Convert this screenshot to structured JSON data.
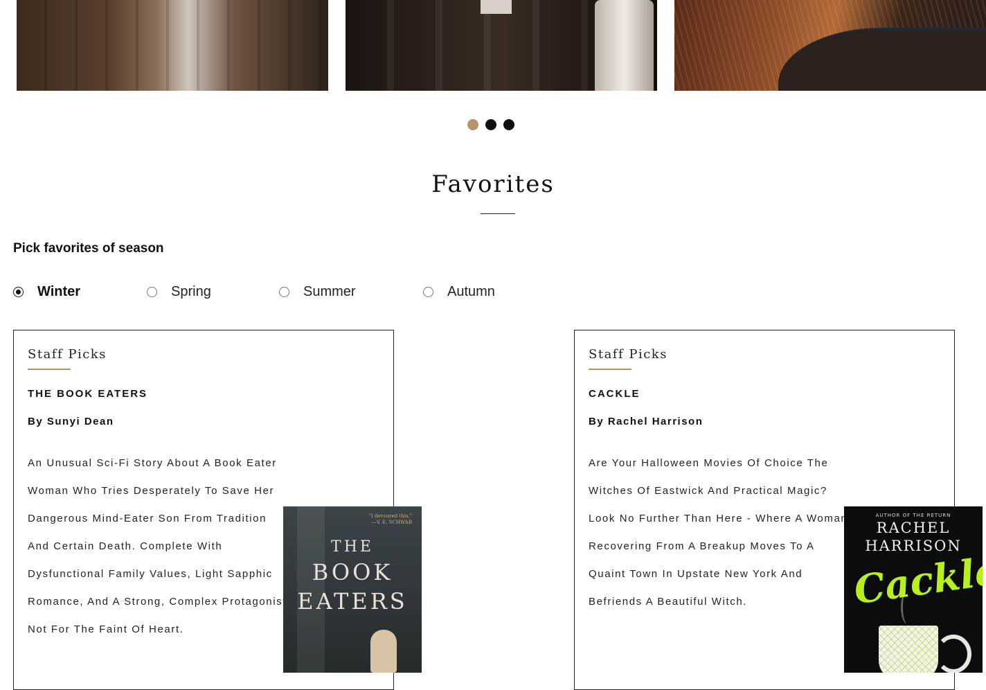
{
  "carousel": {
    "slides": [
      {
        "label": "reader-photo"
      },
      {
        "label": "library-hall-photo"
      },
      {
        "label": "curved-bookshelf-photo"
      }
    ],
    "active_index": 0,
    "colors": {
      "active_dot": "#b59466",
      "inactive_dot": "#111111"
    }
  },
  "section": {
    "title": "Favorites"
  },
  "picker": {
    "heading": "Pick favorites of season",
    "options": [
      {
        "label": "Winter",
        "checked": true
      },
      {
        "label": "Spring",
        "checked": false
      },
      {
        "label": "Summer",
        "checked": false
      },
      {
        "label": "Autumn",
        "checked": false
      }
    ]
  },
  "cards": [
    {
      "kicker": "Staff Picks",
      "title": "THE BOOK EATERS",
      "author": "By Sunyi Dean",
      "description": "An Unusual Sci-Fi Story About A Book Eater Woman Who Tries Desperately To Save Her Dangerous Mind-Eater Son From Tradition And Certain Death. Complete With Dysfunctional Family Values, Light Sapphic Romance, And A Strong, Complex Protagonist. Not For The Faint Of Heart.",
      "cover": {
        "quote_line1": "\"I devoured this.\"",
        "quote_line2": "—V. E. SCHWAB",
        "title_line1": "THE",
        "title_line2": "BOOK",
        "title_line3": "EATERS"
      }
    },
    {
      "kicker": "Staff Picks",
      "title": "CACKLE",
      "author": "By Rachel Harrison",
      "description": "Are Your Halloween Movies Of Choice The Witches Of Eastwick And Practical Magic? Look No Further Than Here - Where A Woman Recovering From A Breakup Moves To A Quaint Town In Upstate New York And Befriends A Beautiful Witch.",
      "cover": {
        "kicker": "AUTHOR OF THE RETURN",
        "author_line1": "RACHEL",
        "author_line2": "HARRISON",
        "logo_text": "Cackle"
      }
    }
  ],
  "accent_color": "#b59466"
}
